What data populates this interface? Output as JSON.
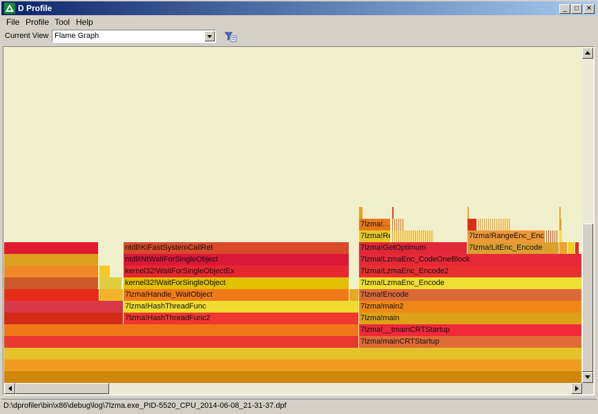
{
  "window": {
    "title": "D Profile",
    "minimize": "_",
    "maximize": "□",
    "close": "✕"
  },
  "menu": [
    "File",
    "Profile",
    "Tool",
    "Help"
  ],
  "toolbar": {
    "current_view_label": "Current View",
    "current_view_value": "Flame Graph"
  },
  "status": {
    "path": "D:\\dprofiler\\bin\\x86\\debug\\log\\7lzma.exe_PID-5520_CPU_2014-06-08_21-31-37.dpf"
  },
  "flame_frames": [
    {
      "label": "",
      "color": "#d0860a"
    },
    {
      "label": "",
      "color": "#f09a20"
    },
    {
      "label": "",
      "color": "#e6c22a"
    },
    {
      "label": "",
      "color": "#e83830"
    },
    {
      "label": "7lzma!mainCRTStartup",
      "color": "#e06a38"
    },
    {
      "label": "",
      "color": "#f07818"
    },
    {
      "label": "7lzma!__tmainCRTStartup",
      "color": "#f02838"
    },
    {
      "label": "",
      "color": "#d42a18"
    },
    {
      "label": "7lzma!HashThreadFunc2",
      "color": "#f03830"
    },
    {
      "label": "7lzma!main",
      "color": "#dea218"
    },
    {
      "label": "",
      "color": "#d83848"
    },
    {
      "label": "7lzma!HashThreadFunc",
      "color": "#eedc30"
    },
    {
      "label": "7lzma!main2",
      "color": "#f08818"
    },
    {
      "label": "",
      "color": "#e62c18"
    },
    {
      "label": "",
      "color": "#f0b428"
    },
    {
      "label": "7lzma!Handle_WaitObject",
      "color": "#f07a1a"
    },
    {
      "label": "",
      "color": "#e8a820"
    },
    {
      "label": "7lzma!Encode",
      "color": "#dc6a38"
    },
    {
      "label": "",
      "color": "#cc5a28"
    },
    {
      "label": "",
      "color": "#e0cc40"
    },
    {
      "label": "kernel32!WaitForSingleObject",
      "color": "#e0c000"
    },
    {
      "label": "7lzma!LzmaEnc_Encode",
      "color": "#eee030"
    },
    {
      "label": "",
      "color": "#f08a28"
    },
    {
      "label": "",
      "color": "#f8c828"
    },
    {
      "label": "kernel32!WaitForSingleObjectEx",
      "color": "#e82830"
    },
    {
      "label": "7lzma!LzmaEnc_Encode2",
      "color": "#e83030"
    },
    {
      "label": "",
      "color": "#dca020"
    },
    {
      "label": "ntdll!NtWaitForSingleObject",
      "color": "#dc1838"
    },
    {
      "label": "7lzma!LzmaEnc_CodeOneBlock",
      "color": "#e82838"
    },
    {
      "label": "",
      "color": "#e01830"
    },
    {
      "label": "ntdll!KiFastSystemCallRet",
      "color": "#d84a28"
    },
    {
      "label": "7lzma!GetOptimum",
      "color": "#e02838"
    },
    {
      "label": "7lzma!LitEnc_Encode",
      "color": "#dca030"
    },
    {
      "label": "",
      "color": "#f0a030"
    },
    {
      "label": "",
      "color": "#f0d020"
    },
    {
      "label": "7lzma!Read...",
      "color": "#e8c828"
    },
    {
      "label": "7lzma!RangeEnc_Enc...",
      "color": "#f09838"
    },
    {
      "label": "",
      "color": "#f0e050"
    },
    {
      "label": "7lzma!...",
      "color": "#e87818"
    },
    {
      "label": "",
      "color": "#d83018"
    },
    {
      "label": "",
      "color": "#f0a020"
    },
    {
      "label": "",
      "color": "#f0a020"
    },
    {
      "label": "",
      "color": "#f0a020"
    }
  ]
}
